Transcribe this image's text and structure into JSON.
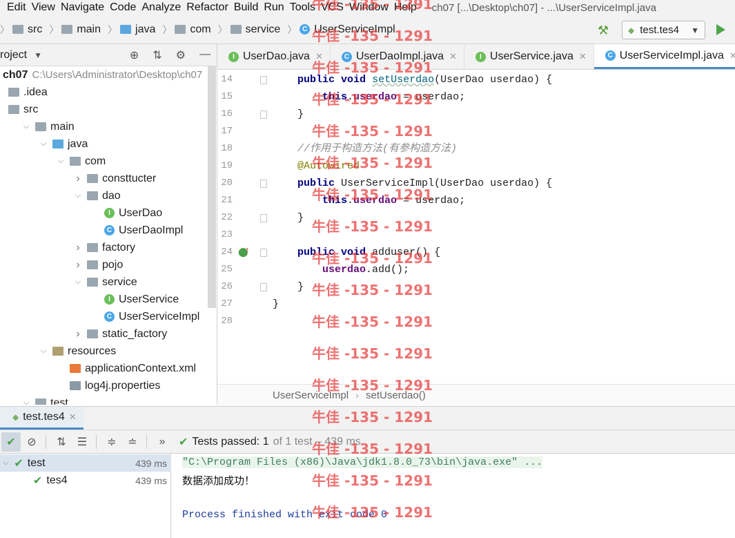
{
  "menu": [
    "Edit",
    "View",
    "Navigate",
    "Code",
    "Analyze",
    "Refactor",
    "Build",
    "Run",
    "Tools",
    "VCS",
    "Window",
    "Help"
  ],
  "window_title": "ch07 [...\\Desktop\\ch07] - ...\\UserServiceImpl.java",
  "breadcrumbs": [
    "src",
    "main",
    "java",
    "com",
    "service",
    "UserServiceImpl"
  ],
  "run_config": {
    "label": "test.tes4"
  },
  "project": {
    "header": "roject",
    "root_name": "ch07",
    "root_path": "C:\\Users\\Administrator\\Desktop\\ch07",
    "tree": [
      {
        "label": ".idea",
        "depth": 0,
        "arrow": "",
        "icon": "folder"
      },
      {
        "label": "src",
        "depth": 0,
        "arrow": "",
        "icon": "folder"
      },
      {
        "label": "main",
        "depth": 1,
        "arrow": "open",
        "icon": "folder"
      },
      {
        "label": "java",
        "depth": 2,
        "arrow": "open",
        "icon": "folder-blue"
      },
      {
        "label": "com",
        "depth": 3,
        "arrow": "open",
        "icon": "folder"
      },
      {
        "label": "consttucter",
        "depth": 4,
        "arrow": "closed",
        "icon": "folder"
      },
      {
        "label": "dao",
        "depth": 4,
        "arrow": "open",
        "icon": "folder"
      },
      {
        "label": "UserDao",
        "depth": 5,
        "arrow": "",
        "icon": "interface"
      },
      {
        "label": "UserDaoImpl",
        "depth": 5,
        "arrow": "",
        "icon": "class"
      },
      {
        "label": "factory",
        "depth": 4,
        "arrow": "closed",
        "icon": "folder"
      },
      {
        "label": "pojo",
        "depth": 4,
        "arrow": "closed",
        "icon": "folder"
      },
      {
        "label": "service",
        "depth": 4,
        "arrow": "open",
        "icon": "folder"
      },
      {
        "label": "UserService",
        "depth": 5,
        "arrow": "",
        "icon": "interface"
      },
      {
        "label": "UserServiceImpl",
        "depth": 5,
        "arrow": "",
        "icon": "class"
      },
      {
        "label": "static_factory",
        "depth": 4,
        "arrow": "closed",
        "icon": "folder"
      },
      {
        "label": "resources",
        "depth": 2,
        "arrow": "open",
        "icon": "folder-res"
      },
      {
        "label": "applicationContext.xml",
        "depth": 3,
        "arrow": "",
        "icon": "xml"
      },
      {
        "label": "log4j.properties",
        "depth": 3,
        "arrow": "",
        "icon": "props"
      },
      {
        "label": "test",
        "depth": 1,
        "arrow": "open",
        "icon": "folder"
      }
    ]
  },
  "tabs": [
    {
      "label": "UserDao.java",
      "icon": "interface",
      "active": false
    },
    {
      "label": "UserDaoImpl.java",
      "icon": "class",
      "active": false
    },
    {
      "label": "UserService.java",
      "icon": "interface",
      "active": false
    },
    {
      "label": "UserServiceImpl.java",
      "icon": "class",
      "active": true
    }
  ],
  "editor": {
    "lines": [
      {
        "n": "14",
        "html": "    <span class=\"kw\">public void</span> <span class=\"fn ul\">setUserdao</span>(UserDao userdao) {"
      },
      {
        "n": "15",
        "html": "        <span class=\"kw\">this</span>.<span class=\"fld\">userdao</span> = userdao;"
      },
      {
        "n": "16",
        "html": "    }"
      },
      {
        "n": "17",
        "html": ""
      },
      {
        "n": "18",
        "html": "    <span class=\"cm\">//作用于构造方法(有参构造方法)</span>"
      },
      {
        "n": "19",
        "html": "    <span class=\"an\">@Autowired</span>"
      },
      {
        "n": "20",
        "html": "    <span class=\"kw\">public</span> UserServiceImpl(UserDao userdao) {"
      },
      {
        "n": "21",
        "html": "        <span class=\"kw\">this</span>.<span class=\"fld\">userdao</span> = userdao;"
      },
      {
        "n": "22",
        "html": "    }"
      },
      {
        "n": "23",
        "html": ""
      },
      {
        "n": "24",
        "html": "    <span class=\"kw\">public void</span> adduser() {"
      },
      {
        "n": "25",
        "html": "        <span class=\"fld\">userdao</span>.add();"
      },
      {
        "n": "26",
        "html": "    }"
      },
      {
        "n": "27",
        "html": "}"
      },
      {
        "n": "28",
        "html": ""
      }
    ],
    "status_class": "UserServiceImpl",
    "status_method": "setUserdao()"
  },
  "run": {
    "tab_label": "test.tes4",
    "passed_label": "Tests passed:",
    "passed_count": "1",
    "passed_total": "of 1 test – 439 ms",
    "tree": [
      {
        "label": "test",
        "ms": "439 ms",
        "depth": 0
      },
      {
        "label": "tes4",
        "ms": "439 ms",
        "depth": 1
      }
    ],
    "console": {
      "cmd": "\"C:\\Program Files (x86)\\Java\\jdk1.8.0_73\\bin\\java.exe\" ...",
      "output": "数据添加成功！",
      "finished": "Process finished with exit code 0"
    }
  },
  "watermark": "牛佳 -135 - 1291"
}
